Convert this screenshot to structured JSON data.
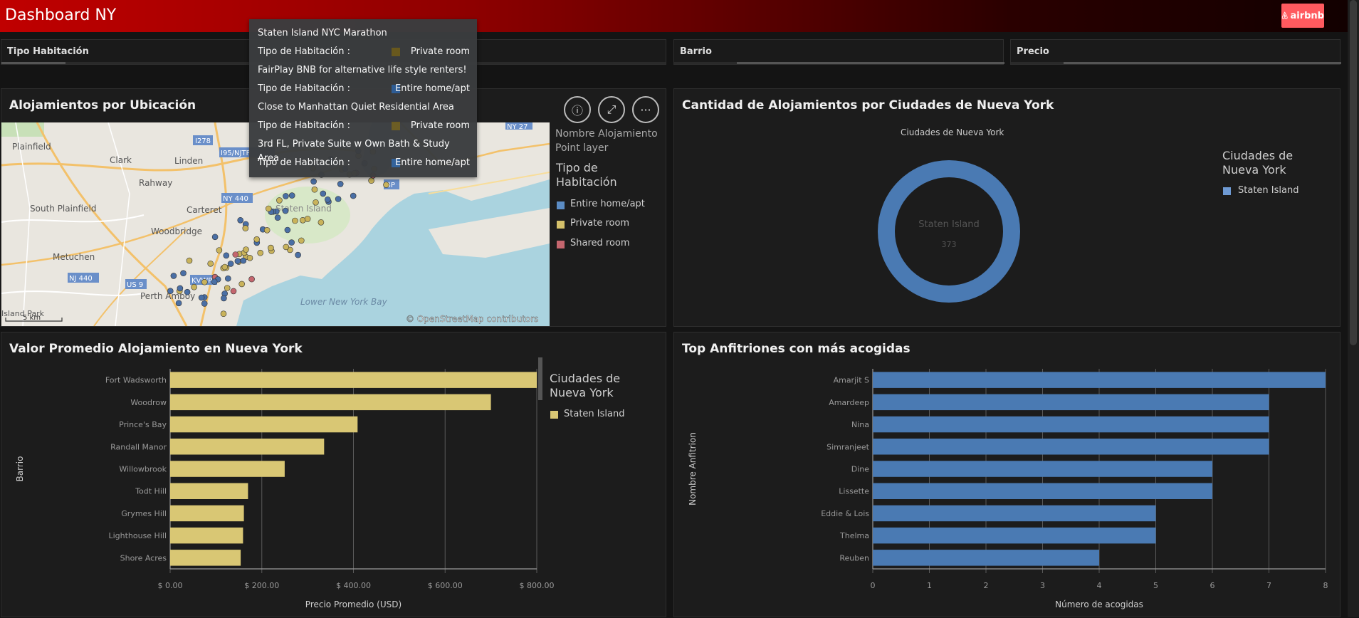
{
  "header": {
    "title": "Dashboard NY",
    "logo_text": "airbnb"
  },
  "filters": [
    "Tipo Habitación",
    "Barrio",
    "Precio"
  ],
  "map_panel": {
    "title": "Alojamientos por Ubicación",
    "legend_layer": "Nombre Alojamiento",
    "legend_layer_sub": "Point layer",
    "legend_title": "Tipo de Habitación",
    "legend_items": [
      {
        "label": "Entire home/apt",
        "color": "#5b8cc4"
      },
      {
        "label": "Private room",
        "color": "#d4c06a"
      },
      {
        "label": "Shared room",
        "color": "#c4666e"
      }
    ],
    "attribution": "© OpenStreetMap contributors",
    "scale": "5 km",
    "place_labels": [
      "Plainfield",
      "Clark",
      "Linden",
      "Rahway",
      "South Plainfield",
      "Carteret",
      "Woodbridge",
      "Metuchen",
      "Perth Amboy",
      "Staten Island",
      "Lower New York Bay",
      "Island Park"
    ],
    "road_labels": [
      "I278",
      "I95/NJTP",
      "NY 440",
      "NJ 440",
      "US 9",
      "KVWP",
      "BP",
      "NY 27"
    ]
  },
  "tooltip": {
    "items": [
      {
        "name": "Staten Island NYC Marathon",
        "key": "Tipo de Habitación :",
        "value": "Private room",
        "color": "#6b5a1e"
      },
      {
        "name": "FairPlay BNB for alternative life style renters!",
        "key": "Tipo de Habitación :",
        "value": "Entire home/apt",
        "color": "#2f5f99"
      },
      {
        "name": "Close to Manhattan Quiet Residential Area",
        "key": "Tipo de Habitación :",
        "value": "Private room",
        "color": "#6b5a1e"
      },
      {
        "name": "3rd FL, Private Suite w Own Bath & Study Area",
        "key": "Tipo de Habitación :",
        "value": "Entire home/apt",
        "color": "#2f5f99"
      }
    ]
  },
  "donut_panel": {
    "title": "Cantidad de Alojamientos por Ciudades de Nueva York",
    "chart_title": "Ciudades de Nueva York",
    "center_label": "Staten Island",
    "center_value": "373",
    "legend_title": "Ciudades de Nueva York",
    "legend_item": "Staten Island",
    "color": "#4a7ab3"
  },
  "price_panel": {
    "title": "Valor Promedio Alojamiento en Nueva York",
    "legend_title": "Ciudades de Nueva York",
    "legend_item": "Staten Island"
  },
  "hosts_panel": {
    "title": "Top Anfitriones con más acogidas"
  },
  "chart_data": [
    {
      "type": "pie",
      "title": "Ciudades de Nueva York",
      "categories": [
        "Staten Island"
      ],
      "values": [
        373
      ]
    },
    {
      "type": "bar",
      "orientation": "horizontal",
      "title": "Valor Promedio Alojamiento en Nueva York",
      "categories": [
        "Fort Wadsworth",
        "Woodrow",
        "Prince's Bay",
        "Randall Manor",
        "Willowbrook",
        "Todt Hill",
        "Grymes Hill",
        "Lighthouse Hill",
        "Shore Acres"
      ],
      "values": [
        800,
        700,
        409,
        336,
        250,
        170,
        161,
        159,
        154
      ],
      "xlabel": "Precio Promedio (USD)",
      "ylabel": "Barrio",
      "xlim": [
        0,
        800
      ],
      "ticks": [
        "$ 0.00",
        "$ 200.00",
        "$ 400.00",
        "$ 600.00",
        "$ 800.00"
      ],
      "tick_values": [
        0,
        200,
        400,
        600,
        800
      ],
      "series": [
        {
          "name": "Staten Island",
          "color": "#d9c774"
        }
      ]
    },
    {
      "type": "bar",
      "orientation": "horizontal",
      "title": "Top Anfitriones con más acogidas",
      "categories": [
        "Amarjit S",
        "Amardeep",
        "Nina",
        "Simranjeet",
        "Dine",
        "Lissette",
        "Eddie & Lois",
        "Thelma",
        "Reuben"
      ],
      "values": [
        8,
        7,
        7,
        7,
        6,
        6,
        5,
        5,
        4
      ],
      "xlabel": "Número de acogidas",
      "ylabel": "Nombre Anfitrion",
      "xlim": [
        0,
        8
      ],
      "ticks": [
        "0",
        "1",
        "2",
        "3",
        "4",
        "5",
        "6",
        "7",
        "8"
      ],
      "tick_values": [
        0,
        1,
        2,
        3,
        4,
        5,
        6,
        7,
        8
      ],
      "series": [
        {
          "color": "#4a7ab3"
        }
      ]
    }
  ]
}
